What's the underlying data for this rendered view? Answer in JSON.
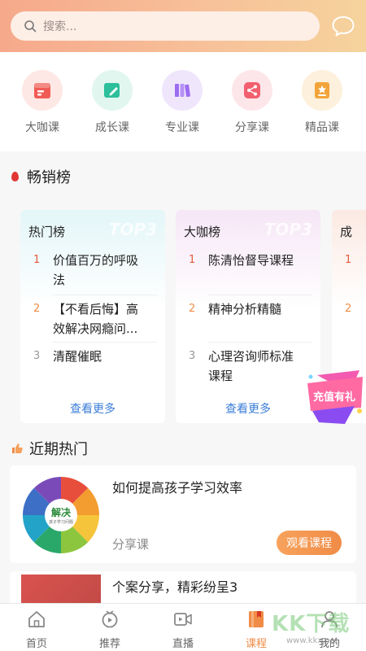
{
  "search": {
    "placeholder": "搜索..."
  },
  "categories": [
    {
      "label": "大咖课",
      "icon": "calendar-icon",
      "color": "#f05c55",
      "bg": "#fde8e6"
    },
    {
      "label": "成长课",
      "icon": "edit-icon",
      "color": "#2bbf9b",
      "bg": "#e1f6ef"
    },
    {
      "label": "专业课",
      "icon": "books-icon",
      "color": "#9c6cf0",
      "bg": "#efe6fc"
    },
    {
      "label": "分享课",
      "icon": "share-icon",
      "color": "#f2606f",
      "bg": "#fde6ea"
    },
    {
      "label": "精品课",
      "icon": "award-icon",
      "color": "#f2a43a",
      "bg": "#fdf0dc"
    }
  ],
  "bestseller": {
    "title": "畅销榜",
    "boards": [
      {
        "title": "热门榜",
        "watermark": "TOP3",
        "items": [
          {
            "rank": "1",
            "lines": [
              "价值百万的呼吸",
              "法"
            ]
          },
          {
            "rank": "2",
            "lines": [
              "【不看后悔】高",
              "效解决网瘾问..."
            ]
          },
          {
            "rank": "3",
            "lines": [
              "清醒催眠"
            ]
          }
        ],
        "more": "查看更多"
      },
      {
        "title": "大咖榜",
        "watermark": "TOP3",
        "items": [
          {
            "rank": "1",
            "lines": [
              "陈清怡督导课程"
            ]
          },
          {
            "rank": "2",
            "lines": [
              "精神分析精髓"
            ]
          },
          {
            "rank": "3",
            "lines": [
              "心理咨询师标准",
              "课程"
            ]
          }
        ],
        "more": "查看更多"
      },
      {
        "title": "成",
        "items": [
          {
            "rank": "1"
          },
          {
            "rank": "2"
          }
        ]
      }
    ],
    "promo_text": "充值有礼"
  },
  "recent": {
    "title": "近期热门",
    "courses": [
      {
        "title": "如何提高孩子学习效率",
        "type": "分享课",
        "button": "观看课程",
        "thumb_center": "解决",
        "thumb_sub": "孩子学习问题"
      },
      {
        "title": "个案分享，精彩纷呈3"
      }
    ]
  },
  "tabs": [
    {
      "label": "首页",
      "icon": "home-icon"
    },
    {
      "label": "推荐",
      "icon": "recommend-icon"
    },
    {
      "label": "直播",
      "icon": "live-icon"
    },
    {
      "label": "课程",
      "icon": "course-icon",
      "active": true
    },
    {
      "label": "我的",
      "icon": "profile-icon"
    }
  ],
  "watermark": {
    "text": "KK下载",
    "url": "www.kkx.net"
  },
  "colors": {
    "accent": "#f08c47",
    "link": "#3b7dd8",
    "rank_hot": "#e25c3c",
    "rank_normal": "#999999"
  }
}
